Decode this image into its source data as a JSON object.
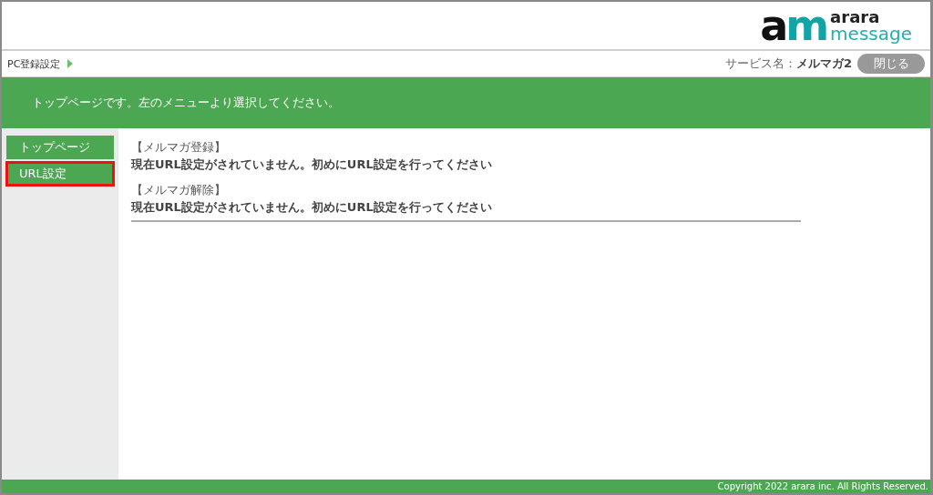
{
  "logo": {
    "mark": "am",
    "line_1": "arara",
    "line_2": "message"
  },
  "breadcrumb": {
    "label": "PC登録設定"
  },
  "service": {
    "label": "サービス名：",
    "value": "メルマガ2"
  },
  "close_button": "閉じる",
  "banner": "トップページです。左のメニューより選択してください。",
  "sidebar": {
    "items": [
      {
        "label": "トップページ",
        "highlighted": false
      },
      {
        "label": "URL設定",
        "highlighted": true
      }
    ]
  },
  "sections": [
    {
      "heading": "【メルマガ登録】",
      "message": "現在URL設定がされていません。初めにURL設定を行ってください"
    },
    {
      "heading": "【メルマガ解除】",
      "message": "現在URL設定がされていません。初めにURL設定を行ってください"
    }
  ],
  "footer": "Copyright 2022 arara inc. All Rights Reserved."
}
